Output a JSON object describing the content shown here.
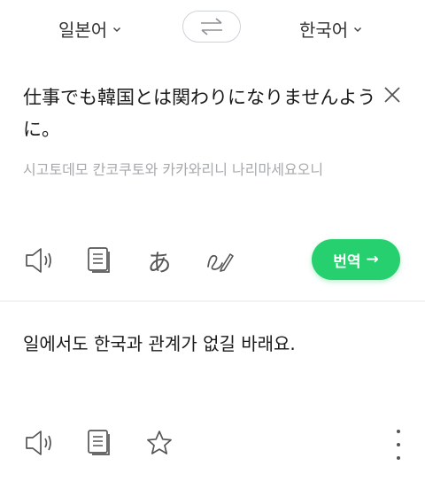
{
  "header": {
    "source_lang": "일본어",
    "target_lang": "한국어",
    "chevron_icon": "chevron-down-icon",
    "swap_icon": "swap-arrows-icon"
  },
  "source": {
    "text": "仕事でも韓国とは関わりになりませんように。",
    "pronunciation": "시고토데모 칸코쿠토와 카카와리니 나리마세요오니",
    "clear_icon": "close-icon",
    "tools": [
      "speaker-icon",
      "copy-icon",
      "hiragana-icon",
      "handwriting-icon"
    ],
    "hiragana_glyph": "あ"
  },
  "translate_button": {
    "label": "번역",
    "arrow": "→",
    "color": "#27d06e"
  },
  "target": {
    "text": "일에서도 한국과 관계가 없길 바래요.",
    "tools": [
      "speaker-icon",
      "copy-icon",
      "star-icon",
      "more-vertical-icon"
    ]
  }
}
